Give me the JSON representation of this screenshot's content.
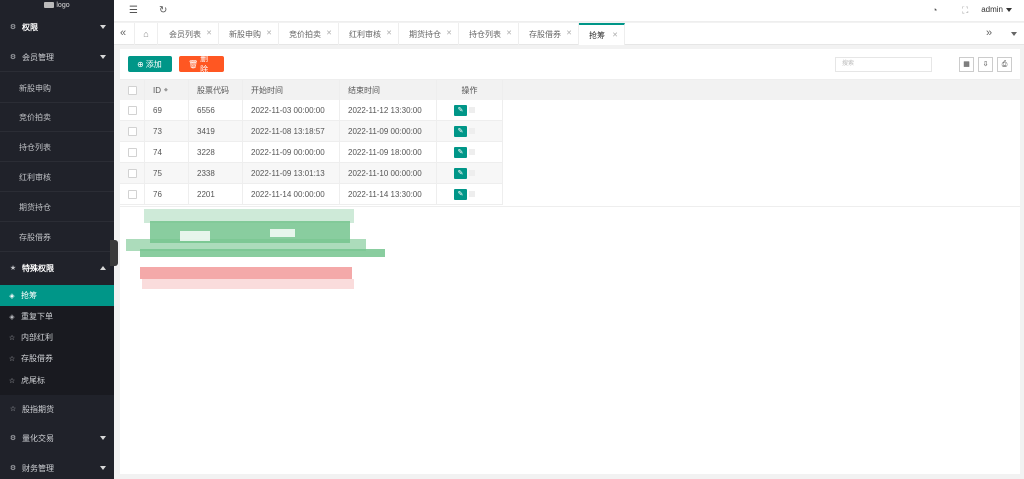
{
  "logo": {
    "text": "logo"
  },
  "sidebar": {
    "items": [
      {
        "label": "权限",
        "icon": "gear-icon"
      },
      {
        "label": "会员管理",
        "icon": "gear-icon"
      },
      {
        "label": "新股申购"
      },
      {
        "label": "竞价拍卖"
      },
      {
        "label": "持仓列表"
      },
      {
        "label": "红利审核"
      },
      {
        "label": "期货持仓"
      },
      {
        "label": "存股借券"
      },
      {
        "label": "特殊权限",
        "icon": "star-icon"
      },
      {
        "label": "抢筹",
        "icon": "diamond-icon"
      },
      {
        "label": "重复下单",
        "icon": "diamond-icon"
      },
      {
        "label": "内部红利",
        "icon": "star-icon"
      },
      {
        "label": "存股借券",
        "icon": "star-icon"
      },
      {
        "label": "虎尾标",
        "icon": "star-icon"
      },
      {
        "label": "股指期货",
        "icon": "star-icon"
      },
      {
        "label": "量化交易",
        "icon": "gear-icon"
      },
      {
        "label": "财务管理",
        "icon": "gear-icon"
      }
    ]
  },
  "header": {
    "user": "admin"
  },
  "tabs": [
    {
      "label": "会员列表"
    },
    {
      "label": "新股申购"
    },
    {
      "label": "竞价拍卖"
    },
    {
      "label": "红利审核"
    },
    {
      "label": "期货持仓"
    },
    {
      "label": "持仓列表"
    },
    {
      "label": "存股借券"
    },
    {
      "label": "抢筹"
    }
  ],
  "toolbar": {
    "add_label": "添加",
    "delete_label": "删除",
    "search_placeholder": "搜索"
  },
  "table": {
    "columns": [
      "ID",
      "股票代码",
      "开始时间",
      "结束时间",
      "操作"
    ],
    "rows": [
      {
        "id": "69",
        "code": "6556",
        "start": "2022-11-03 00:00:00",
        "end": "2022-11-12 13:30:00"
      },
      {
        "id": "73",
        "code": "3419",
        "start": "2022-11-08 13:18:57",
        "end": "2022-11-09 00:00:00"
      },
      {
        "id": "74",
        "code": "3228",
        "start": "2022-11-09 00:00:00",
        "end": "2022-11-09 18:00:00"
      },
      {
        "id": "75",
        "code": "2338",
        "start": "2022-11-09 13:01:13",
        "end": "2022-11-10 00:00:00"
      },
      {
        "id": "76",
        "code": "2201",
        "start": "2022-11-14 00:00:00",
        "end": "2022-11-14 13:30:00"
      }
    ]
  },
  "colors": {
    "accent": "#009688",
    "danger": "#ff5722",
    "sidebar": "#20222a"
  }
}
